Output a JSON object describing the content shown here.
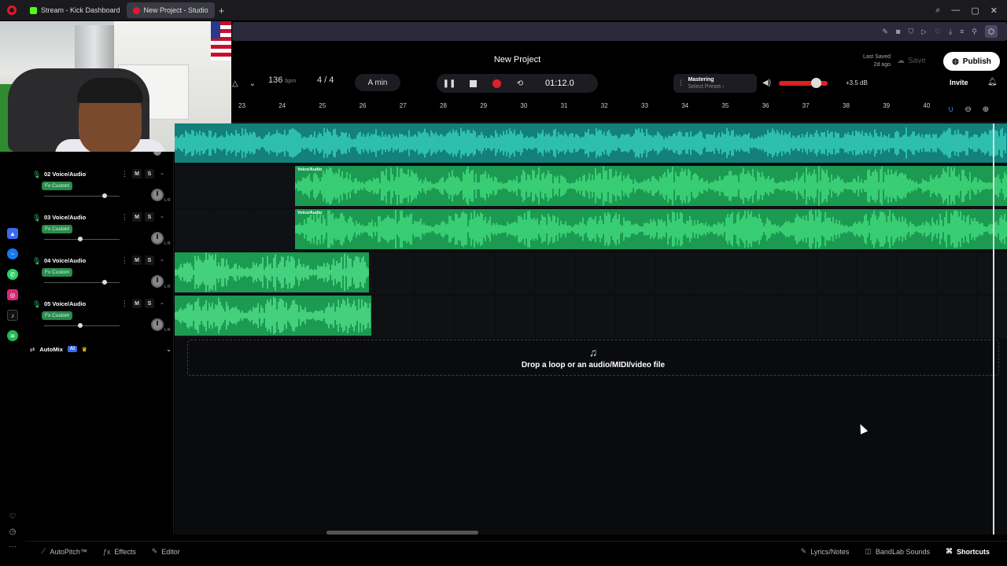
{
  "browser": {
    "tabs": [
      {
        "label": "Stream - Kick Dashboard",
        "color": "#53fc18"
      },
      {
        "label": "New Project - Studio",
        "color": "#e3192d"
      }
    ],
    "new_tab": "+",
    "win_min": "—",
    "win_max": "▢",
    "win_close": "✕",
    "search": "⌕"
  },
  "studio": {
    "project_title": "New Project",
    "last_saved_label": "Last Saved",
    "last_saved_value": "2d ago",
    "save_label": "Save",
    "publish_label": "Publish",
    "bpm": "136",
    "bpm_unit": "bpm",
    "time_signature": "4 / 4",
    "key": "A min",
    "time": "01:12.0",
    "mastering_title": "Mastering",
    "mastering_preset": "Select Preset ›",
    "volume_db": "+3.5 dB",
    "invite_label": "Invite",
    "volume_level": 0.75
  },
  "ruler": {
    "bars": [
      "23",
      "24",
      "25",
      "26",
      "27",
      "28",
      "29",
      "30",
      "31",
      "32",
      "33",
      "34",
      "35",
      "36",
      "37",
      "38",
      "39",
      "40"
    ]
  },
  "tracks": [
    {
      "number": "02",
      "label": "02  Voice/Audio",
      "fx": "Fx Custom",
      "volume": 1.0,
      "clip_label": "Voice/Audio"
    },
    {
      "number": "03",
      "label": "03  Voice/Audio",
      "fx": "Fx Custom",
      "volume": 0.6,
      "clip_label": "Voice/Audio"
    },
    {
      "number": "04",
      "label": "04  Voice/Audio",
      "fx": "Fx Custom",
      "volume": 1.0,
      "clip_label": ""
    },
    {
      "number": "05",
      "label": "05  Voice/Audio",
      "fx": "Fx Custom",
      "volume": 0.6,
      "clip_label": ""
    }
  ],
  "track_controls": {
    "mute": "M",
    "solo": "S",
    "pan_lr": "L  R"
  },
  "automix": {
    "label": "AutoMix",
    "badge": "AI"
  },
  "drop_zone": {
    "text": "Drop a loop or an audio/MIDI/video file"
  },
  "bottom_bar": {
    "autopitch": "AutoPitch™",
    "effects": "Effects",
    "editor": "Editor",
    "lyrics": "Lyrics/Notes",
    "bandlab_sounds": "BandLab Sounds",
    "shortcuts": "Shortcuts"
  },
  "colors": {
    "accent_green": "#1c9a52",
    "master_teal": "#13807a",
    "record_red": "#e0202a",
    "publish_bg": "#ffffff"
  }
}
